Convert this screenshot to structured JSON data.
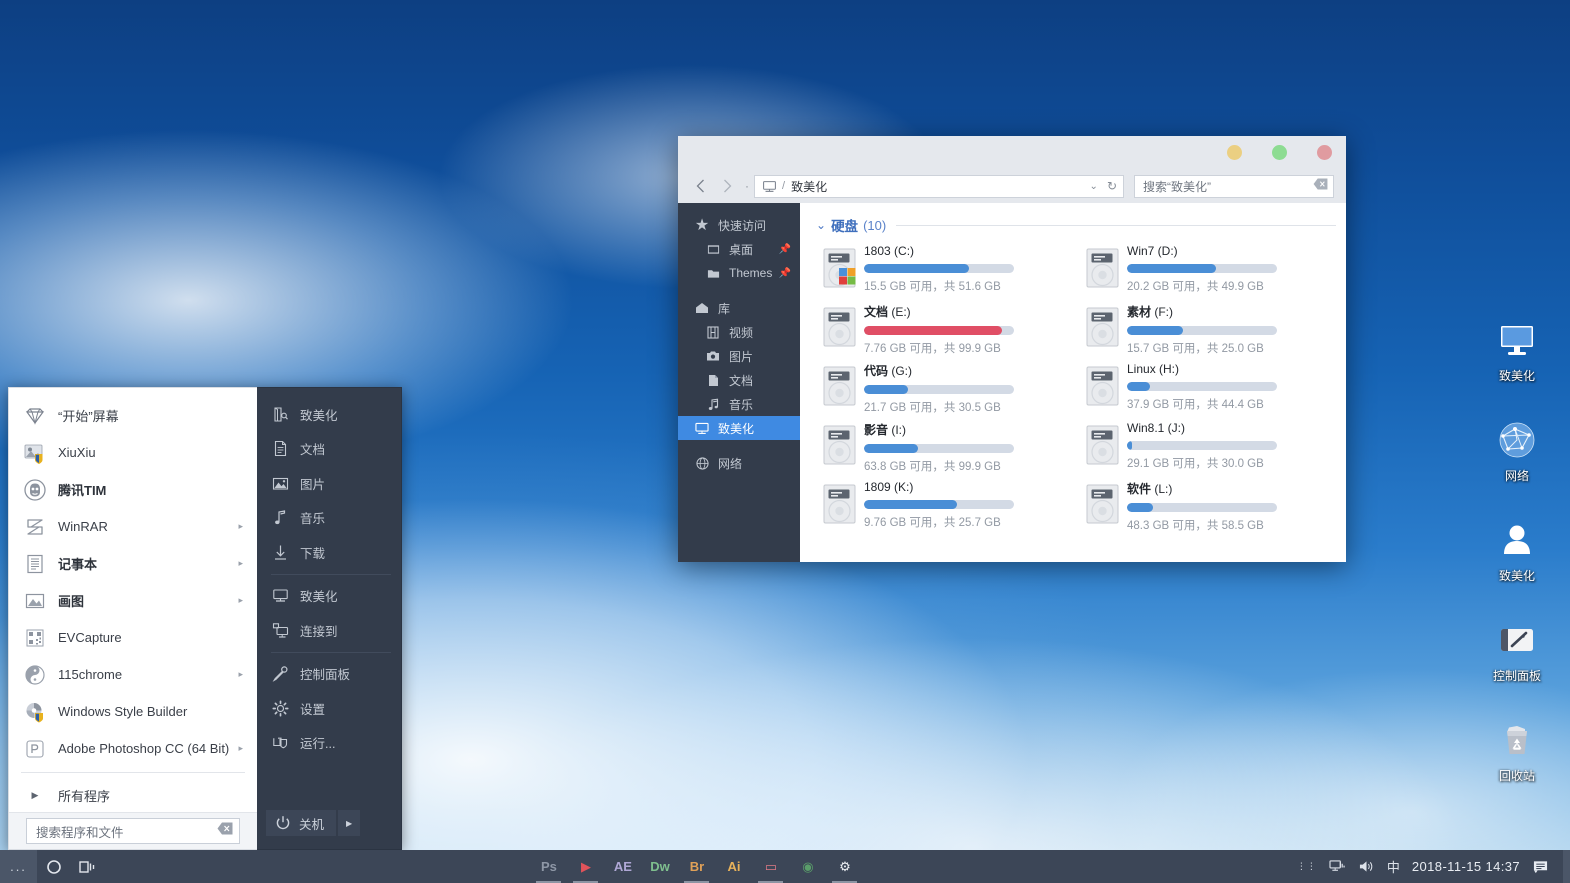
{
  "desktop": {
    "icons": [
      {
        "name": "致美化",
        "glyph": "monitor-icon"
      },
      {
        "name": "网络",
        "glyph": "network-globe-icon"
      },
      {
        "name": "致美化",
        "glyph": "user-icon"
      },
      {
        "name": "控制面板",
        "glyph": "control-panel-icon"
      },
      {
        "name": "回收站",
        "glyph": "recycle-bin-icon"
      }
    ]
  },
  "start_menu": {
    "left_items": [
      {
        "label": "“开始”屏幕",
        "icon": "diamond-icon",
        "arrow": false,
        "bold": false
      },
      {
        "label": "XiuXiu",
        "icon": "photo-shield-icon",
        "arrow": false,
        "bold": false
      },
      {
        "label": "腾讯TIM",
        "icon": "tim-icon",
        "arrow": false,
        "bold": true
      },
      {
        "label": "WinRAR",
        "icon": "winrar-icon",
        "arrow": true,
        "bold": false
      },
      {
        "label": "记事本",
        "icon": "notepad-icon",
        "arrow": true,
        "bold": true
      },
      {
        "label": "画图",
        "icon": "paint-icon",
        "arrow": true,
        "bold": true
      },
      {
        "label": "EVCapture",
        "icon": "evcapture-icon",
        "arrow": false,
        "bold": false
      },
      {
        "label": "115chrome",
        "icon": "chrome115-icon",
        "arrow": true,
        "bold": false
      },
      {
        "label": "Windows Style Builder",
        "icon": "style-builder-icon",
        "arrow": false,
        "bold": false
      },
      {
        "label": "Adobe Photoshop CC (64 Bit)",
        "icon": "photoshop-icon",
        "arrow": true,
        "bold": false
      }
    ],
    "all_programs": {
      "label": "所有程序",
      "icon": "triangle-right-icon"
    },
    "search": {
      "placeholder": "搜索程序和文件",
      "value": "",
      "clear_icon": "clear-icon"
    },
    "right_items": [
      {
        "label": "致美化",
        "icon": "user-folder-icon",
        "sep_after": false
      },
      {
        "label": "文档",
        "icon": "document-icon",
        "sep_after": false
      },
      {
        "label": "图片",
        "icon": "picture-icon",
        "sep_after": false
      },
      {
        "label": "音乐",
        "icon": "music-note-icon",
        "sep_after": false
      },
      {
        "label": "下载",
        "icon": "download-icon",
        "sep_after": true
      },
      {
        "label": "致美化",
        "icon": "computer-icon",
        "sep_after": false
      },
      {
        "label": "连接到",
        "icon": "connect-to-icon",
        "sep_after": true
      },
      {
        "label": "控制面板",
        "icon": "control-panel-key-icon",
        "sep_after": false
      },
      {
        "label": "设置",
        "icon": "gear-icon",
        "sep_after": false
      },
      {
        "label": "运行...",
        "icon": "run-icon",
        "sep_after": false
      }
    ],
    "power": {
      "label": "关机",
      "icon": "power-icon",
      "arrow_icon": "triangle-right-icon"
    }
  },
  "explorer": {
    "window_controls": [
      {
        "name": "minimize",
        "color": "#ebcf82"
      },
      {
        "name": "maximize",
        "color": "#8ddc92"
      },
      {
        "name": "close",
        "color": "#e09ba0"
      }
    ],
    "toolbar": {
      "back_icon": "chevron-left-icon",
      "forward_icon": "chevron-right-icon",
      "recent_icon": "dot-icon",
      "address_icon": "computer-icon",
      "address_separator": "/",
      "address_value": "致美化",
      "dropdown_icon": "chevron-down-icon",
      "refresh_icon": "refresh-icon",
      "search_placeholder": "搜索“致美化”",
      "search_clear_icon": "clear-icon"
    },
    "sidebar": [
      {
        "label": "快速访问",
        "icon": "star-icon",
        "level": 0,
        "pin": false,
        "selected": false,
        "gap_before": false
      },
      {
        "label": "桌面",
        "icon": "desktop-folder-icon",
        "level": 1,
        "pin": true,
        "selected": false,
        "gap_before": false
      },
      {
        "label": "Themes",
        "icon": "folder-icon",
        "level": 1,
        "pin": true,
        "selected": false,
        "gap_before": false
      },
      {
        "label": "库",
        "icon": "library-icon",
        "level": 0,
        "pin": false,
        "selected": false,
        "gap_before": true
      },
      {
        "label": "视频",
        "icon": "video-icon",
        "level": 1,
        "pin": false,
        "selected": false,
        "gap_before": false
      },
      {
        "label": "图片",
        "icon": "camera-icon",
        "level": 1,
        "pin": false,
        "selected": false,
        "gap_before": false
      },
      {
        "label": "文档",
        "icon": "document-icon",
        "level": 1,
        "pin": false,
        "selected": false,
        "gap_before": false
      },
      {
        "label": "音乐",
        "icon": "music-note-icon",
        "level": 1,
        "pin": false,
        "selected": false,
        "gap_before": false
      },
      {
        "label": "致美化",
        "icon": "computer-icon",
        "level": 0,
        "pin": false,
        "selected": true,
        "gap_before": false
      },
      {
        "label": "网络",
        "icon": "network-globe-icon",
        "level": 0,
        "pin": false,
        "selected": false,
        "gap_before": true
      }
    ],
    "group": {
      "caret_icon": "chevron-down-icon",
      "title": "硬盘",
      "count": "(10)"
    },
    "drives": [
      {
        "label": "1803",
        "letter": "(C:)",
        "free": "15.5 GB",
        "total": "51.6 GB",
        "used_pct": 70,
        "color": "#4a8ed6",
        "icon": "windows-drive-icon"
      },
      {
        "label": "Win7",
        "letter": "(D:)",
        "free": "20.2 GB",
        "total": "49.9 GB",
        "used_pct": 59,
        "color": "#4a8ed6",
        "icon": "drive-icon"
      },
      {
        "label": "文档",
        "letter": "(E:)",
        "free": "7.76 GB",
        "total": "99.9 GB",
        "used_pct": 92,
        "color": "#e04e65",
        "icon": "drive-icon",
        "bold": true
      },
      {
        "label": "素材",
        "letter": "(F:)",
        "free": "15.7 GB",
        "total": "25.0 GB",
        "used_pct": 37,
        "color": "#4a8ed6",
        "icon": "drive-icon",
        "bold": true
      },
      {
        "label": "代码",
        "letter": "(G:)",
        "free": "21.7 GB",
        "total": "30.5 GB",
        "used_pct": 29,
        "color": "#4a8ed6",
        "icon": "drive-icon",
        "bold": true
      },
      {
        "label": "Linux",
        "letter": "(H:)",
        "free": "37.9 GB",
        "total": "44.4 GB",
        "used_pct": 15,
        "color": "#4a8ed6",
        "icon": "drive-icon"
      },
      {
        "label": "影音",
        "letter": "(I:)",
        "free": "63.8 GB",
        "total": "99.9 GB",
        "used_pct": 36,
        "color": "#4a8ed6",
        "icon": "drive-icon",
        "bold": true
      },
      {
        "label": "Win8.1",
        "letter": "(J:)",
        "free": "29.1 GB",
        "total": "30.0 GB",
        "used_pct": 3,
        "color": "#4a8ed6",
        "icon": "drive-icon"
      },
      {
        "label": "1809",
        "letter": "(K:)",
        "free": "9.76 GB",
        "total": "25.7 GB",
        "used_pct": 62,
        "color": "#4a8ed6",
        "icon": "drive-icon"
      },
      {
        "label": "软件",
        "letter": "(L:)",
        "free": "48.3 GB",
        "total": "58.5 GB",
        "used_pct": 17,
        "color": "#4a8ed6",
        "icon": "drive-icon",
        "bold": true
      }
    ],
    "free_suffix": " 可用，共 "
  },
  "taskbar": {
    "start_label": "...",
    "pinned_left": [
      {
        "name": "cortana-circle-icon"
      },
      {
        "name": "task-view-icon"
      }
    ],
    "apps": [
      {
        "label": "Ps",
        "color": "#8e97a6",
        "running": true
      },
      {
        "label": "▶",
        "color": "#e0535a",
        "running": true
      },
      {
        "label": "AE",
        "color": "#b0a8d6",
        "running": false
      },
      {
        "label": "Dw",
        "color": "#7fbf8e",
        "running": false
      },
      {
        "label": "Br",
        "color": "#e0a158",
        "running": true
      },
      {
        "label": "Ai",
        "color": "#e8b25a",
        "running": false
      },
      {
        "label": "▭",
        "color": "#e07a86",
        "running": true
      },
      {
        "label": "◉",
        "color": "#5a9e6a",
        "running": false
      },
      {
        "label": "⚙",
        "color": "#eef1f5",
        "running": true
      }
    ],
    "tray": [
      {
        "name": "tray-expand-icon",
        "glyph": "⁞⁞"
      },
      {
        "name": "network-icon",
        "glyph": "network"
      },
      {
        "name": "volume-icon",
        "glyph": "volume"
      },
      {
        "name": "ime-icon",
        "glyph": "中"
      }
    ],
    "clock": "2018-11-15  14:37",
    "action_center_icon": "action-center-icon"
  }
}
